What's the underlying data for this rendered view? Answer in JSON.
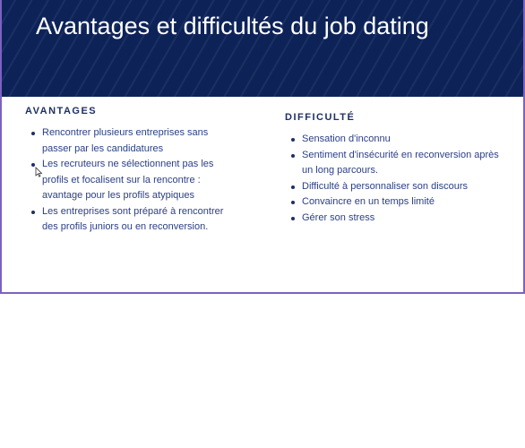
{
  "slide": {
    "title": "Avantages et difficultés du job dating"
  },
  "advantages": {
    "heading": "AVANTAGES",
    "items": [
      "Rencontrer plusieurs entreprises sans passer par les candidatures",
      "Les recruteurs ne sélectionnent pas les profils et focalisent sur la rencontre : avantage pour les profils atypiques",
      "Les entreprises sont préparé à rencontrer des profils juniors ou en reconversion."
    ]
  },
  "difficulties": {
    "heading": "DIFFICULTÉ",
    "items": [
      "Sensation d'inconnu",
      "Sentiment d'insécurité en reconversion après un long parcours.",
      "Difficulté à personnaliser son discours",
      "Convaincre en un temps limité",
      "Gérer son stress"
    ]
  },
  "colors": {
    "banner": "#0d2358",
    "heading": "#1d2f66",
    "body_text": "#2a3f86",
    "frame": "#7c62c2"
  },
  "icons": [
    "mouse-cursor-icon"
  ]
}
